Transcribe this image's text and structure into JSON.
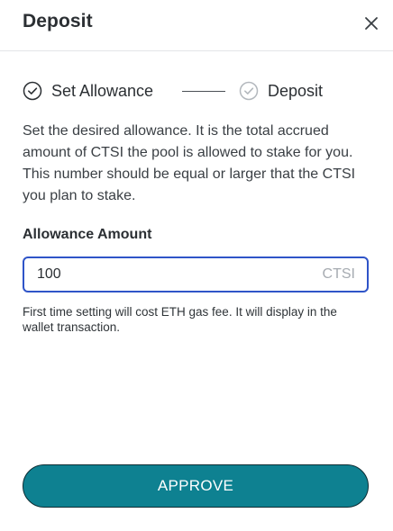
{
  "dialog": {
    "title": "Deposit",
    "close_icon": "close-icon"
  },
  "steps": [
    {
      "label": "Set Allowance",
      "state": "current",
      "icon": "check-circle-icon"
    },
    {
      "label": "Deposit",
      "state": "pending",
      "icon": "check-circle-icon"
    }
  ],
  "description": "Set the desired allowance. It is the total accrued amount of CTSI the pool is allowed to stake for you. This number should be equal or larger that the CTSI you plan to stake.",
  "allowance": {
    "label": "Allowance Amount",
    "value": "100",
    "unit": "CTSI"
  },
  "helper_text": "First time setting will cost ETH gas fee. It will display in the wallet transaction.",
  "approve_button": {
    "label": "APPROVE"
  },
  "colors": {
    "accent_teal": "#0e8191",
    "input_focus_border": "#2f54c8",
    "muted_text": "#a6abb1"
  }
}
